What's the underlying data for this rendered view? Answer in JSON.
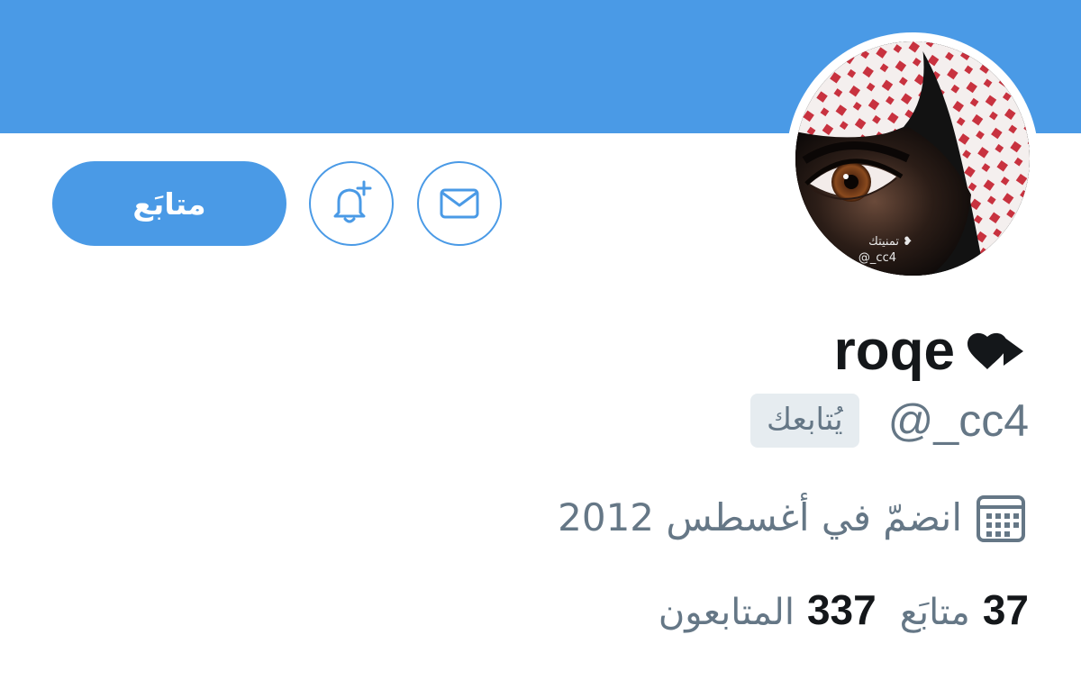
{
  "header": {
    "banner_color": "#4a9ae6"
  },
  "avatar": {
    "overlay_line1": "تمنيتك ❥",
    "overlay_line2": "@_cc4"
  },
  "actions": {
    "follow_label": "متابَع",
    "bell_icon": "bell-plus-icon",
    "mail_icon": "envelope-icon"
  },
  "profile": {
    "display_name": "roqe",
    "name_symbol": "❥",
    "handle": "@_cc4",
    "follows_you": "يُتابعك",
    "joined": "انضمّ في أغسطس 2012",
    "calendar_icon": "calendar-icon"
  },
  "stats": {
    "following_count": "37",
    "following_label": "متابَع",
    "followers_count": "337",
    "followers_label": "المتابعون"
  },
  "colors": {
    "accent": "#4a9ae6",
    "text_primary": "#14171a",
    "text_secondary": "#657786",
    "badge_bg": "#e6ecf0"
  }
}
